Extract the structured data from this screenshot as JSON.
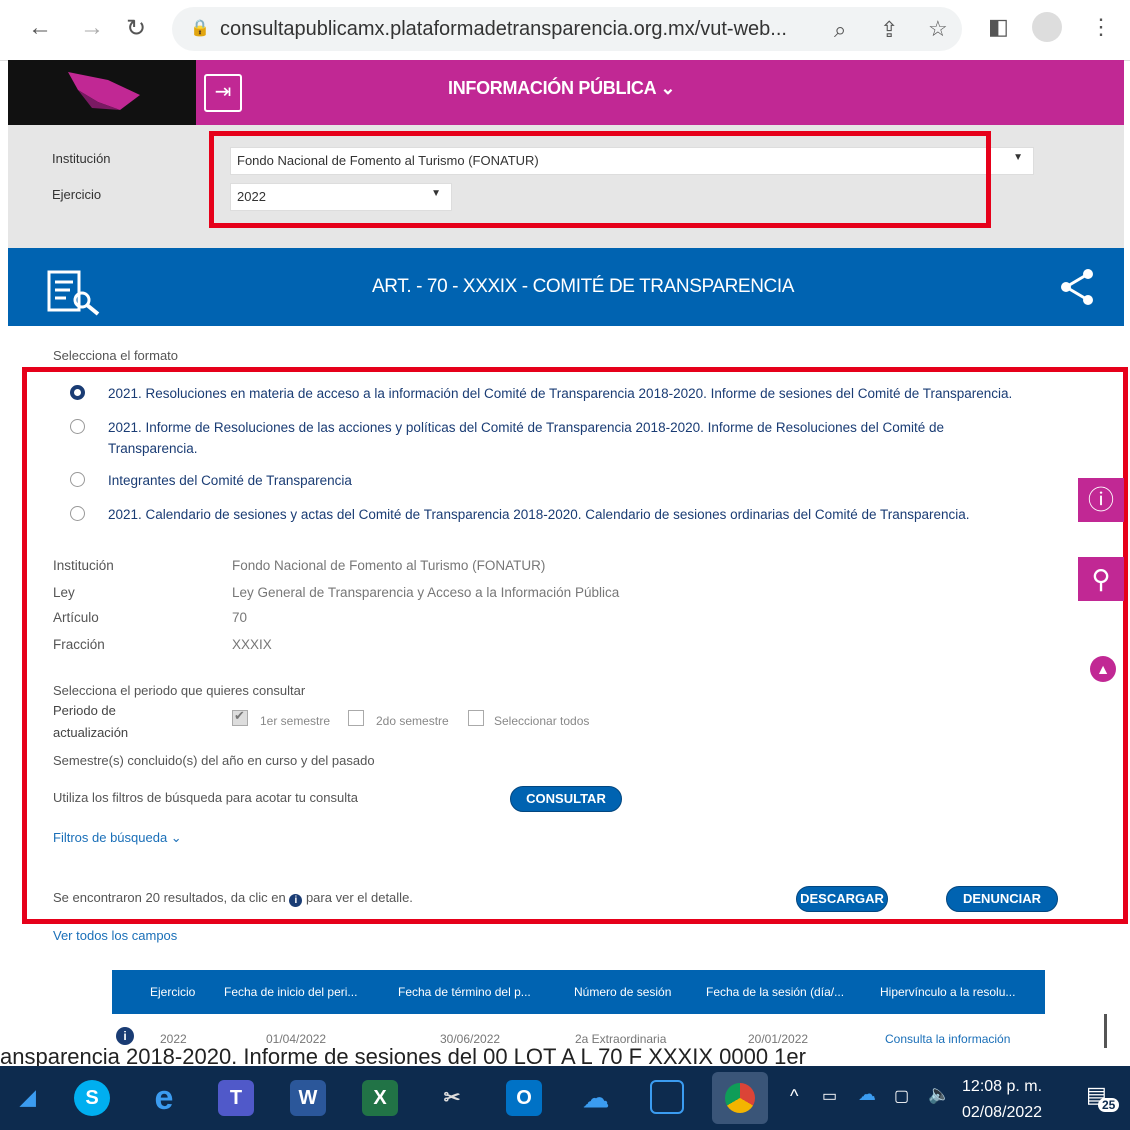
{
  "browser": {
    "url": "consultapublicamx.plataformadetransparencia.org.mx/vut-web...",
    "back_icon": "←",
    "forward_icon": "→",
    "reload_icon": "↻"
  },
  "header": {
    "title": "INFORMACIÓN PÚBLICA",
    "login_icon": "⇥",
    "brand_color": "#c12894"
  },
  "filters": {
    "institucion_label": "Institución",
    "institucion_value": "Fondo Nacional de Fomento al Turismo (FONATUR)",
    "ejercicio_label": "Ejercicio",
    "ejercicio_value": "2022"
  },
  "banner": {
    "title": "ART. - 70 - XXXIX - COMITÉ DE TRANSPARENCIA",
    "color": "#0063b1"
  },
  "format": {
    "label": "Selecciona el formato",
    "options": [
      {
        "text": "2021. Resoluciones en materia de acceso a la información del Comité de Transparencia 2018-2020. Informe de sesiones del Comité de Transparencia.",
        "selected": true
      },
      {
        "text": "2021. Informe de Resoluciones de las acciones y políticas del Comité de Transparencia 2018-2020. Informe de Resoluciones del Comité de Transparencia.",
        "selected": false
      },
      {
        "text": "Integrantes del Comité de Transparencia",
        "selected": false
      },
      {
        "text": "2021. Calendario de sesiones y actas del Comité de Transparencia 2018-2020. Calendario de sesiones ordinarias del Comité de Transparencia.",
        "selected": false
      }
    ]
  },
  "meta": {
    "institucion_label": "Institución",
    "institucion_value": "Fondo Nacional de Fomento al Turismo (FONATUR)",
    "ley_label": "Ley",
    "ley_value": "Ley General de Transparencia y Acceso a la Información Pública",
    "articulo_label": "Artículo",
    "articulo_value": "70",
    "fraccion_label": "Fracción",
    "fraccion_value": "XXXIX"
  },
  "periodo": {
    "prompt": "Selecciona el periodo que quieres consultar",
    "label_line1": "Periodo de",
    "label_line2": "actualización",
    "opt1": "1er semestre",
    "opt2": "2do semestre",
    "opt3": "Seleccionar todos",
    "opt1_checked": true,
    "note": "Semestre(s) concluido(s) del año en curso y del pasado"
  },
  "actions": {
    "filters_prompt": "Utiliza los filtros de búsqueda para acotar tu consulta",
    "consultar": "CONSULTAR",
    "filtros_link": "Filtros de búsqueda ⌄",
    "results_pre": "Se encontraron 20 resultados, da clic en",
    "results_post": "para ver el detalle.",
    "descargar": "DESCARGAR",
    "denunciar": "DENUNCIAR",
    "ver_todos": "Ver todos los campos"
  },
  "table": {
    "headers": [
      "Ejercicio",
      "Fecha de inicio del peri...",
      "Fecha de término del p...",
      "Número de sesión",
      "Fecha de la sesión (día/...",
      "Hipervínculo a la resolu..."
    ],
    "row": [
      "2022",
      "01/04/2022",
      "30/06/2022",
      "2a Extraordinaria",
      "20/01/2022",
      "Consulta la información"
    ]
  },
  "bleed_text": "ansparencia 2018-2020. Informe de sesiones del      00   LOT  A   L 70  F  XXXIX     0000              1er",
  "taskbar": {
    "time": "12:08 p. m.",
    "date": "02/08/2022",
    "notifications": "25"
  }
}
